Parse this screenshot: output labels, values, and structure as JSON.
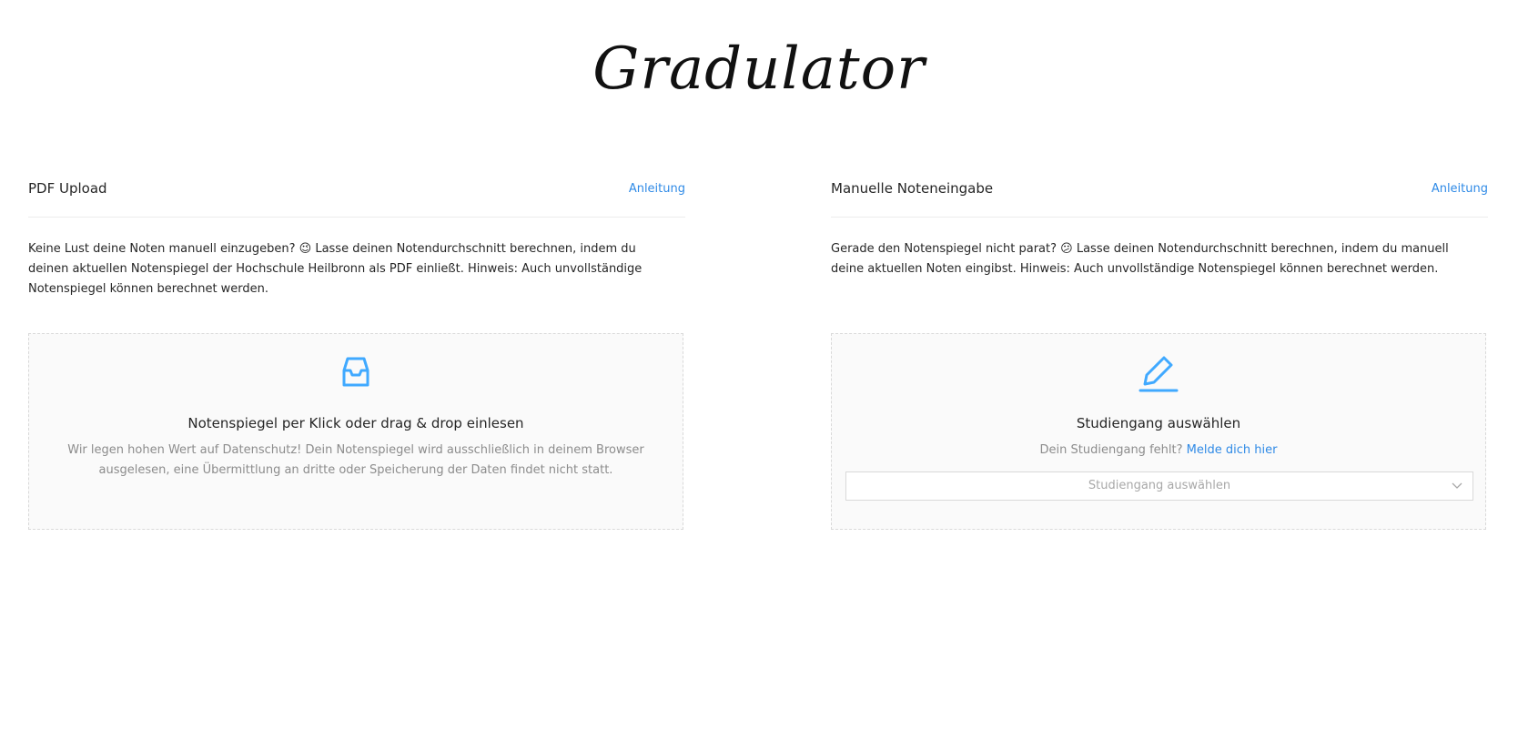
{
  "app": {
    "logo": "Gradulator",
    "accent_color": "#2f8ae6",
    "icon_color": "#40a9ff"
  },
  "pdf_card": {
    "title": "PDF Upload",
    "help_link": "Anleitung",
    "description": "Keine Lust deine Noten manuell einzugeben? 😉 Lasse deinen Notendurchschnitt berechnen, indem du deinen aktuellen Notenspiegel der Hochschule Heilbronn als PDF einließt. Hinweis: Auch unvollständige Notenspiegel können berechnet werden.",
    "dropzone": {
      "icon": "inbox-icon",
      "title": "Notenspiegel per Klick oder drag & drop einlesen",
      "hint": "Wir legen hohen Wert auf Datenschutz! Dein Notenspiegel wird ausschließlich in deinem Browser ausgelesen, eine Übermittlung an dritte oder Speicherung der Daten findet nicht statt."
    }
  },
  "manual_card": {
    "title": "Manuelle Noteneingabe",
    "help_link": "Anleitung",
    "description": "Gerade den Notenspiegel nicht parat? 😕 Lasse deinen Notendurchschnitt berechnen, indem du manuell deine aktuellen Noten eingibst. Hinweis: Auch unvollständige Notenspiegel können berechnet werden.",
    "panel": {
      "icon": "edit-icon",
      "title": "Studiengang auswählen",
      "hint_text": "Dein Studiengang fehlt?",
      "hint_link": "Melde dich hier",
      "select_placeholder": "Studiengang auswählen"
    }
  }
}
